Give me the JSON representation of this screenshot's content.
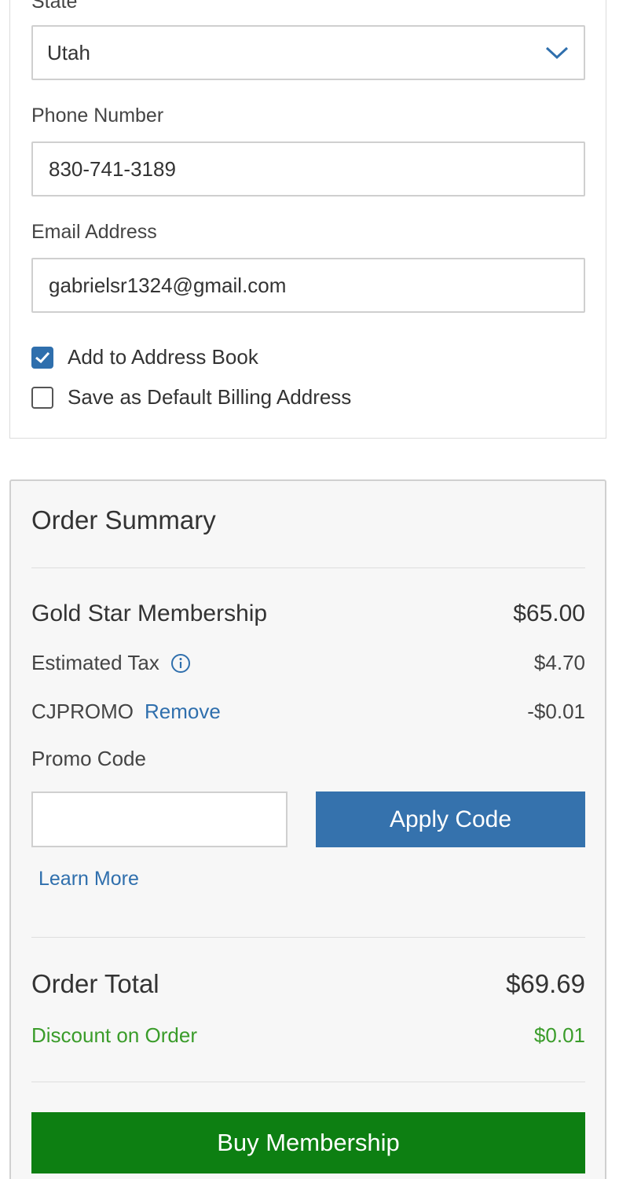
{
  "billing": {
    "state_label": "State",
    "state_value": "Utah",
    "phone_label": "Phone Number",
    "phone_value": "830-741-3189",
    "email_label": "Email Address",
    "email_value": "gabrielsr1324@gmail.com",
    "add_to_address_book": {
      "label": "Add to Address Book",
      "checked": true
    },
    "save_default_billing": {
      "label": "Save as Default Billing Address",
      "checked": false
    }
  },
  "summary": {
    "title": "Order Summary",
    "item_name": "Gold Star Membership",
    "item_price": "$65.00",
    "tax_label": "Estimated Tax",
    "tax_value": "$4.70",
    "promo_applied_code": "CJPROMO",
    "remove_label": "Remove",
    "promo_discount": "-$0.01",
    "promo_code_label": "Promo Code",
    "promo_code_value": "",
    "apply_button": "Apply Code",
    "learn_more": "Learn More",
    "order_total_label": "Order Total",
    "order_total_value": "$69.69",
    "discount_label": "Discount on Order",
    "discount_value": "$0.01",
    "buy_button": "Buy Membership"
  },
  "colors": {
    "primary_blue": "#3572ad",
    "buy_green": "#0d7f12",
    "discount_green": "#3a9c2a"
  },
  "icons": [
    "chevron-down-icon",
    "checkmark-icon",
    "info-icon"
  ]
}
